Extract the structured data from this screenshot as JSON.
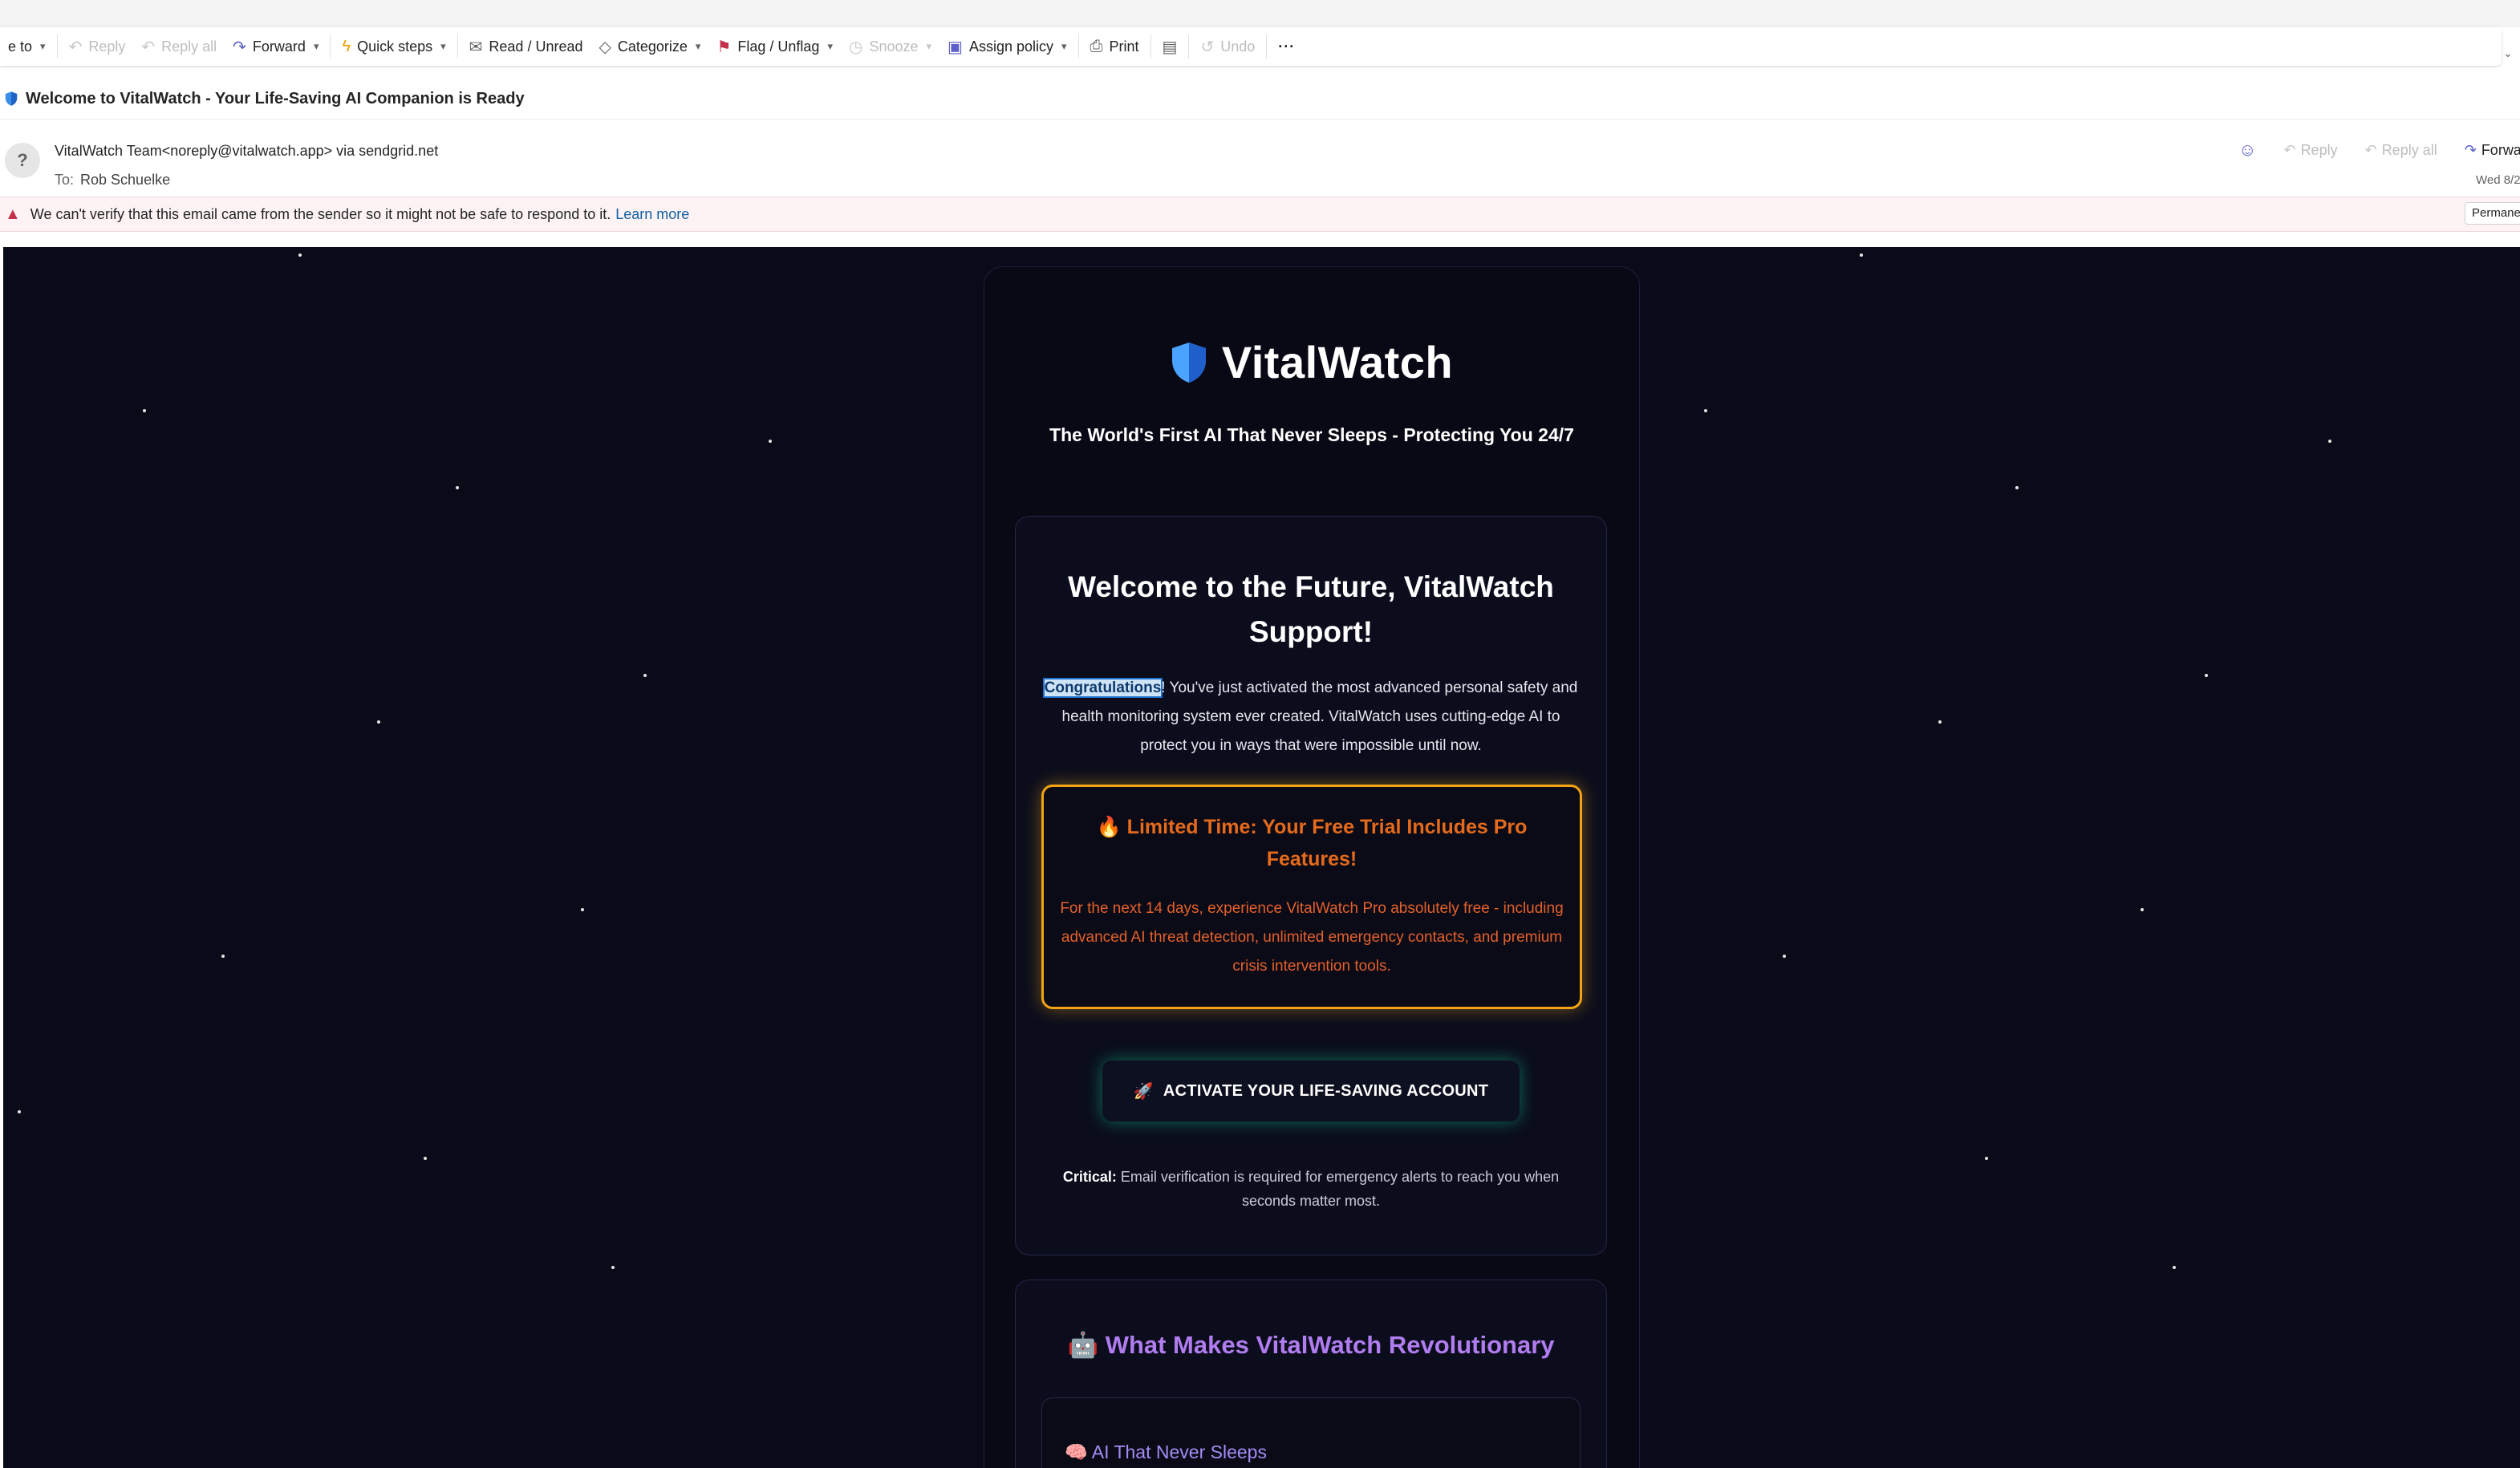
{
  "toolbar": {
    "move_label": "e to",
    "reply": "Reply",
    "reply_all": "Reply all",
    "forward": "Forward",
    "quick_steps": "Quick steps",
    "read_unread": "Read / Unread",
    "categorize": "Categorize",
    "flag": "Flag / Unflag",
    "snooze": "Snooze",
    "assign_policy": "Assign policy",
    "print": "Print",
    "undo": "Undo",
    "more": "···"
  },
  "message": {
    "subject": "Welcome to VitalWatch - Your Life-Saving AI Companion is Ready",
    "avatar": "?",
    "from": "VitalWatch Team<noreply@vitalwatch.app> via sendgrid.net",
    "to_label": "To:",
    "to": "Rob Schuelke",
    "date": "Wed 8/2",
    "actions": {
      "reply": "Reply",
      "reply_all": "Reply all",
      "forward": "Forwa"
    },
    "warning": "We can't verify that this email came from the sender so it might not be safe to respond to it.",
    "learn_more": "Learn more",
    "permanent": "Permane"
  },
  "email": {
    "brand": "VitalWatch",
    "tagline": "The World's First AI That Never Sleeps - Protecting You 24/7",
    "welcome_title": "Welcome to the Future, VitalWatch Support!",
    "intro_highlight": "Congratulations",
    "intro_rest": "! You've just activated the most advanced personal safety and health monitoring system ever created. VitalWatch uses cutting-edge AI to protect you in ways that were impossible until now.",
    "promo_title": "Limited Time: Your Free Trial Includes Pro Features!",
    "promo_text": "For the next 14 days, experience VitalWatch Pro absolutely free - including advanced AI threat detection, unlimited emergency contacts, and premium crisis intervention tools.",
    "cta_label": "ACTIVATE YOUR LIFE-SAVING ACCOUNT",
    "critical_label": "Critical:",
    "critical_text": " Email verification is required for emergency alerts to reach you when seconds matter most.",
    "revolutionary_title": "What Makes VitalWatch Revolutionary",
    "feature1_title": "AI That Never Sleeps"
  },
  "icons": {
    "shield": "shield-icon",
    "fire": "fire-icon",
    "rocket": "rocket-icon",
    "robot": "robot-icon",
    "brain": "brain-icon"
  },
  "colors": {
    "email_bg": "#0a0b18",
    "promo_border": "#f2a314",
    "promo_text": "#e5602a",
    "cta_glow": "#10b981",
    "purple_heading": "#b07cf0",
    "link": "#115ea3",
    "warning_bg": "#fdf3f4"
  }
}
